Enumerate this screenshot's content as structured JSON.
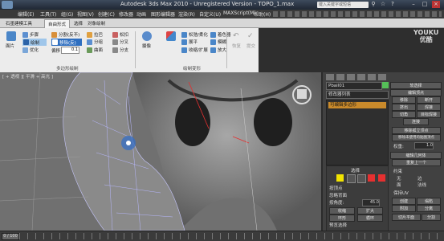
{
  "window": {
    "title": "Autodesk 3ds Max  2010 - Unregistered Version - TOPO_1.max",
    "search_placeholder": "键入关键字或短语",
    "watermark_line1": "YOUKU",
    "watermark_line2": "优酷"
  },
  "menubar": [
    "编辑(E)",
    "工具(T)",
    "组(G)",
    "视图(V)",
    "创建(C)",
    "修改器",
    "动画",
    "图形编辑器",
    "渲染(R)",
    "自定义(U)",
    "MAXScript(M)",
    "帮助(H)"
  ],
  "ribbon_tabs": [
    "石墨建模工具",
    "自由形式",
    "选择",
    "对象绘制"
  ],
  "ribbon": {
    "polygon_label": "面片",
    "tools_a": [
      "步骤",
      "绘制",
      "优化"
    ],
    "tools_b": [
      "分割(反不)",
      "移除(反)",
      "偏移"
    ],
    "offset_label": "偏移",
    "offset_value": "0.1",
    "tools_c": [
      "拉巴",
      "分组",
      "曲面"
    ],
    "tools_d": [
      "松扣",
      "分叉",
      "分支"
    ],
    "section1_label": "多边形绘制",
    "tools_e": [
      "摄像",
      "松弛/柔化",
      "着色器",
      "收缩/扩展"
    ],
    "tools_f": [
      "模糊",
      "展平",
      "放大"
    ],
    "section2_label": "绘制变形",
    "tools_g": [
      "恢复",
      "提交"
    ]
  },
  "viewport": {
    "label": "[ + 透视 ][ 平滑 + 高光 ]"
  },
  "command_panel": {
    "object_name": "Pbail01",
    "modifier_list_label": "修改器列表",
    "stack_item": "可编辑多边形",
    "selection_title": "选择",
    "selection_options": [
      "按顶点",
      "忽略背面",
      "按角度:"
    ],
    "angle_value": "45.0",
    "shrink_label": "收缩",
    "grow_label": "扩大",
    "ring_label": "环形",
    "loop_label": "循环",
    "preview_title": "预览选择",
    "preview_options": [
      "禁用",
      "子对象",
      "多个"
    ],
    "right_title": "软选择",
    "edit_vertices_title": "编辑顶点",
    "right_buttons": [
      "移除",
      "断开",
      "挤出",
      "焊接",
      "切角",
      "目标焊接",
      "连接"
    ],
    "remove_isolated": "移除孤立顶点",
    "remove_unused": "移除未使用的贴图顶点",
    "weight_label": "权重:",
    "weight_value": "1.0",
    "edit_geo_title": "编辑几何体",
    "repeat_last": "重复上一个",
    "constraints_label": "约束",
    "constraint_opts": [
      "无",
      "边",
      "面",
      "法线"
    ],
    "preserve_uv": "保持UV",
    "create_label": "创建",
    "collapse_label": "塌陷",
    "attach_label": "附加",
    "detach_label": "分离",
    "slice_plane": "切片平面",
    "split_label": "分割"
  },
  "timeline": {
    "frame": "0 / 100"
  },
  "colors": {
    "accent_orange": "#c98a2b",
    "selection_yellow": "#f2e400",
    "selection_red": "#e53030"
  }
}
